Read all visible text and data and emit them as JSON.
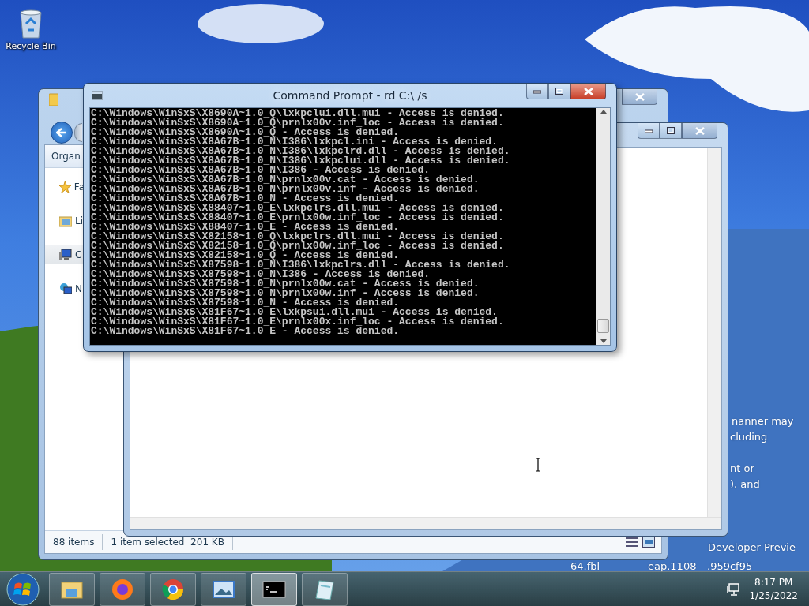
{
  "desktop": {
    "icons": [
      {
        "label": "Recycle Bin"
      }
    ],
    "wallpaper_text": [
      "nanner may",
      "cluding",
      "nt or",
      "), and",
      "Developer Previe",
      "64.fbl",
      "eap.1108",
      ".959cf95"
    ]
  },
  "explorer": {
    "toolbar": [
      "Organ"
    ],
    "sidebar": [
      {
        "label": "Fa",
        "kind": "star",
        "selected": false
      },
      {
        "label": "Li",
        "kind": "library",
        "selected": false
      },
      {
        "label": "C",
        "kind": "computer",
        "selected": true
      },
      {
        "label": "N",
        "kind": "network",
        "selected": false
      }
    ],
    "status_bar": {
      "item_count": "88 items",
      "selection": "1 item selected  201 KB"
    }
  },
  "console": {
    "title": "Command Prompt - rd  C:\\ /s",
    "lines": [
      "C:\\Windows\\WinSxS\\X8690A~1.0_Q\\lxkpclui.dll.mui - Access is denied.",
      "C:\\Windows\\WinSxS\\X8690A~1.0_Q\\prnlx00v.inf_loc - Access is denied.",
      "C:\\Windows\\WinSxS\\X8690A~1.0_Q - Access is denied.",
      "C:\\Windows\\WinSxS\\X8A67B~1.0_N\\I386\\lxkpcl.ini - Access is denied.",
      "C:\\Windows\\WinSxS\\X8A67B~1.0_N\\I386\\lxkpclrd.dll - Access is denied.",
      "C:\\Windows\\WinSxS\\X8A67B~1.0_N\\I386\\lxkpclui.dll - Access is denied.",
      "C:\\Windows\\WinSxS\\X8A67B~1.0_N\\I386 - Access is denied.",
      "C:\\Windows\\WinSxS\\X8A67B~1.0_N\\prnlx00v.cat - Access is denied.",
      "C:\\Windows\\WinSxS\\X8A67B~1.0_N\\prnlx00v.inf - Access is denied.",
      "C:\\Windows\\WinSxS\\X8A67B~1.0_N - Access is denied.",
      "C:\\Windows\\WinSxS\\X88407~1.0_E\\lxkpclrs.dll.mui - Access is denied.",
      "C:\\Windows\\WinSxS\\X88407~1.0_E\\prnlx00w.inf_loc - Access is denied.",
      "C:\\Windows\\WinSxS\\X88407~1.0_E - Access is denied.",
      "C:\\Windows\\WinSxS\\X82158~1.0_Q\\lxkpclrs.dll.mui - Access is denied.",
      "C:\\Windows\\WinSxS\\X82158~1.0_Q\\prnlx00w.inf_loc - Access is denied.",
      "C:\\Windows\\WinSxS\\X82158~1.0_Q - Access is denied.",
      "C:\\Windows\\WinSxS\\X87598~1.0_N\\I386\\lxkpclrs.dll - Access is denied.",
      "C:\\Windows\\WinSxS\\X87598~1.0_N\\I386 - Access is denied.",
      "C:\\Windows\\WinSxS\\X87598~1.0_N\\prnlx00w.cat - Access is denied.",
      "C:\\Windows\\WinSxS\\X87598~1.0_N\\prnlx00w.inf - Access is denied.",
      "C:\\Windows\\WinSxS\\X87598~1.0_N - Access is denied.",
      "C:\\Windows\\WinSxS\\X81F67~1.0_E\\lxkpsui.dll.mui - Access is denied.",
      "C:\\Windows\\WinSxS\\X81F67~1.0_E\\prnlx00x.inf_loc - Access is denied.",
      "C:\\Windows\\WinSxS\\X81F67~1.0_E - Access is denied."
    ]
  },
  "taskbar": {
    "apps": [
      {
        "kind": "folder",
        "selected": false
      },
      {
        "kind": "firefox",
        "selected": false
      },
      {
        "kind": "chrome",
        "selected": false
      },
      {
        "kind": "picture",
        "selected": false
      },
      {
        "kind": "console",
        "selected": true
      },
      {
        "kind": "notepad",
        "selected": false
      }
    ],
    "clock": {
      "time": "8:17 PM",
      "date": "1/25/2022"
    }
  }
}
